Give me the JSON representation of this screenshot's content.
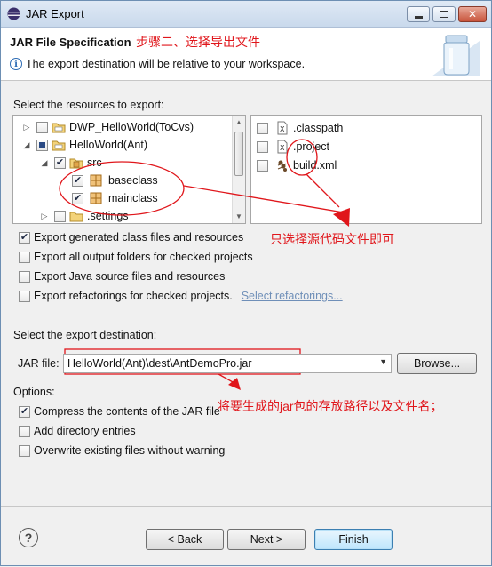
{
  "window": {
    "title": "JAR Export"
  },
  "header": {
    "title": "JAR File Specification",
    "annotation": "步骤二、选择导出文件",
    "info": "The export destination will be relative to your workspace."
  },
  "resources": {
    "label": "Select the resources to export:",
    "tree": [
      {
        "label": "DWP_HelloWorld(ToCvs)",
        "checked": "none"
      },
      {
        "label": "HelloWorld(Ant)",
        "checked": "partial"
      },
      {
        "label": "src",
        "checked": "checked"
      },
      {
        "label": "baseclass",
        "checked": "checked"
      },
      {
        "label": "mainclass",
        "checked": "checked"
      },
      {
        "label": ".settings",
        "checked": "none"
      }
    ],
    "files": [
      {
        "label": ".classpath",
        "checked": "none"
      },
      {
        "label": ".project",
        "checked": "none"
      },
      {
        "label": "build.xml",
        "checked": "none"
      }
    ],
    "annotation": "只选择源代码文件即可"
  },
  "options_top": [
    {
      "label": "Export generated class files and resources",
      "checked": true
    },
    {
      "label": "Export all output folders for checked projects",
      "checked": false
    },
    {
      "label": "Export Java source files and resources",
      "checked": false
    },
    {
      "label": "Export refactorings for checked projects.",
      "checked": false
    }
  ],
  "select_refactorings": "Select refactorings...",
  "destination": {
    "label": "Select the export destination:",
    "jar_label": "JAR file:",
    "jar_value": "HelloWorld(Ant)\\dest\\AntDemoPro.jar",
    "browse": "Browse...",
    "annotation": "将要生成的jar包的存放路径以及文件名；"
  },
  "options": {
    "label": "Options:",
    "items": [
      {
        "label": "Compress the contents of the JAR file",
        "checked": true
      },
      {
        "label": "Add directory entries",
        "checked": false
      },
      {
        "label": "Overwrite existing files without warning",
        "checked": false
      }
    ]
  },
  "buttons": {
    "back": "< Back",
    "next": "Next >",
    "finish": "Finish"
  },
  "colors": {
    "annotation": "#e0161b",
    "title_bar": "#c9d9ec",
    "link": "#6f8fb8"
  }
}
